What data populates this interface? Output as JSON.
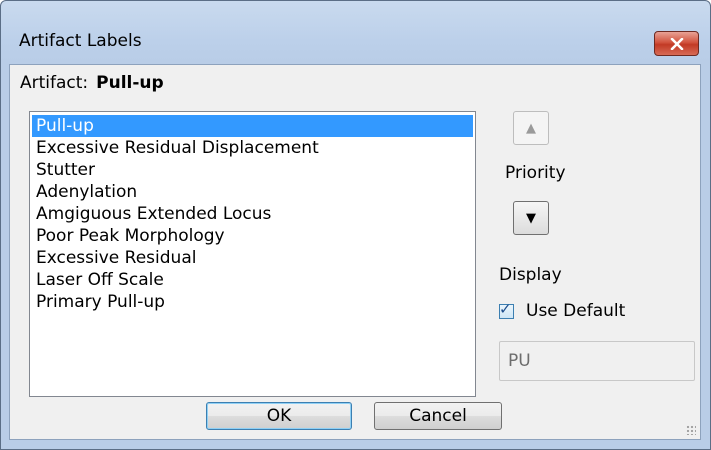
{
  "window": {
    "title": "Artifact Labels",
    "close_glyph": "✕"
  },
  "artifact": {
    "label": "Artifact:",
    "value": "Pull-up"
  },
  "list": {
    "items": [
      "Pull-up",
      "Excessive Residual Displacement",
      "Stutter",
      "Adenylation",
      "Amgiguous Extended Locus",
      "Poor Peak Morphology",
      "Excessive Residual",
      "Laser Off Scale",
      "Primary Pull-up"
    ],
    "selected_index": 0
  },
  "priority": {
    "label": "Priority",
    "up_glyph": "▲",
    "down_glyph": "▼"
  },
  "display": {
    "label": "Display",
    "use_default_label": "Use Default",
    "use_default_checked": true,
    "code_value": "PU"
  },
  "buttons": {
    "ok": "OK",
    "cancel": "Cancel"
  },
  "colors": {
    "selection": "#3399ff",
    "close_button": "#c23a25"
  }
}
